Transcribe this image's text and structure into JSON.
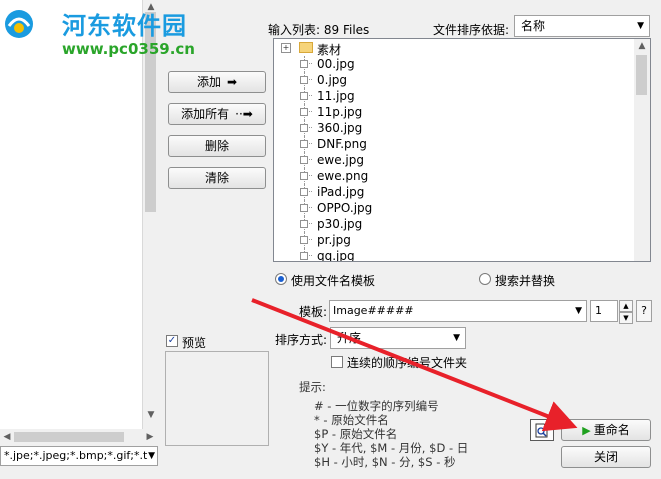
{
  "watermark": {
    "title": "河东软件园",
    "url": "www.pc0359.cn"
  },
  "left_panel": {
    "filter_value": "*.jpe;*.jpeg;*.bmp;*.gif;*.t"
  },
  "buttons": {
    "add": "添加",
    "add_all": "添加所有",
    "remove": "删除",
    "clear": "清除",
    "rename": "重命名",
    "close": "关闭"
  },
  "input_list": {
    "label": "输入列表:",
    "count": "89 Files",
    "sort_label": "文件排序依据:",
    "sort_value": "名称",
    "items": [
      {
        "name": "素材",
        "type": "folder"
      },
      {
        "name": "00.jpg",
        "type": "file"
      },
      {
        "name": "0.jpg",
        "type": "file"
      },
      {
        "name": "11.jpg",
        "type": "file"
      },
      {
        "name": "11p.jpg",
        "type": "file"
      },
      {
        "name": "360.jpg",
        "type": "file"
      },
      {
        "name": "DNF.png",
        "type": "file"
      },
      {
        "name": "ewe.jpg",
        "type": "file"
      },
      {
        "name": "ewe.png",
        "type": "file"
      },
      {
        "name": "iPad.jpg",
        "type": "file"
      },
      {
        "name": "OPPO.jpg",
        "type": "file"
      },
      {
        "name": "p30.jpg",
        "type": "file"
      },
      {
        "name": "pr.jpg",
        "type": "file"
      },
      {
        "name": "qq.jpg",
        "type": "file"
      }
    ]
  },
  "mode": {
    "template_option": "使用文件名模板",
    "search_replace_option": "搜索并替换",
    "selected": "template"
  },
  "template": {
    "label": "模板:",
    "value": "Image#####",
    "start_number": "1",
    "help": "?"
  },
  "sort_method": {
    "label": "排序方式:",
    "value": "升序"
  },
  "continuous_folder": {
    "label": "连续的顺序编号文件夹",
    "checked": false
  },
  "preview": {
    "label": "预览",
    "checked": true
  },
  "hints": {
    "title": "提示:",
    "lines": [
      "# - 一位数字的序列编号",
      "*  - 原始文件名",
      "$P - 原始文件名",
      "$Y - 年代,    $M - 月份,    $D - 日",
      "$H - 小时,     $N - 分,     $S - 秒"
    ]
  },
  "colors": {
    "accent_arrow": "#e8212a",
    "rename_icon": "#1ea01e",
    "watermark_blue": "#1a9be0",
    "watermark_green": "#2aa52a"
  }
}
